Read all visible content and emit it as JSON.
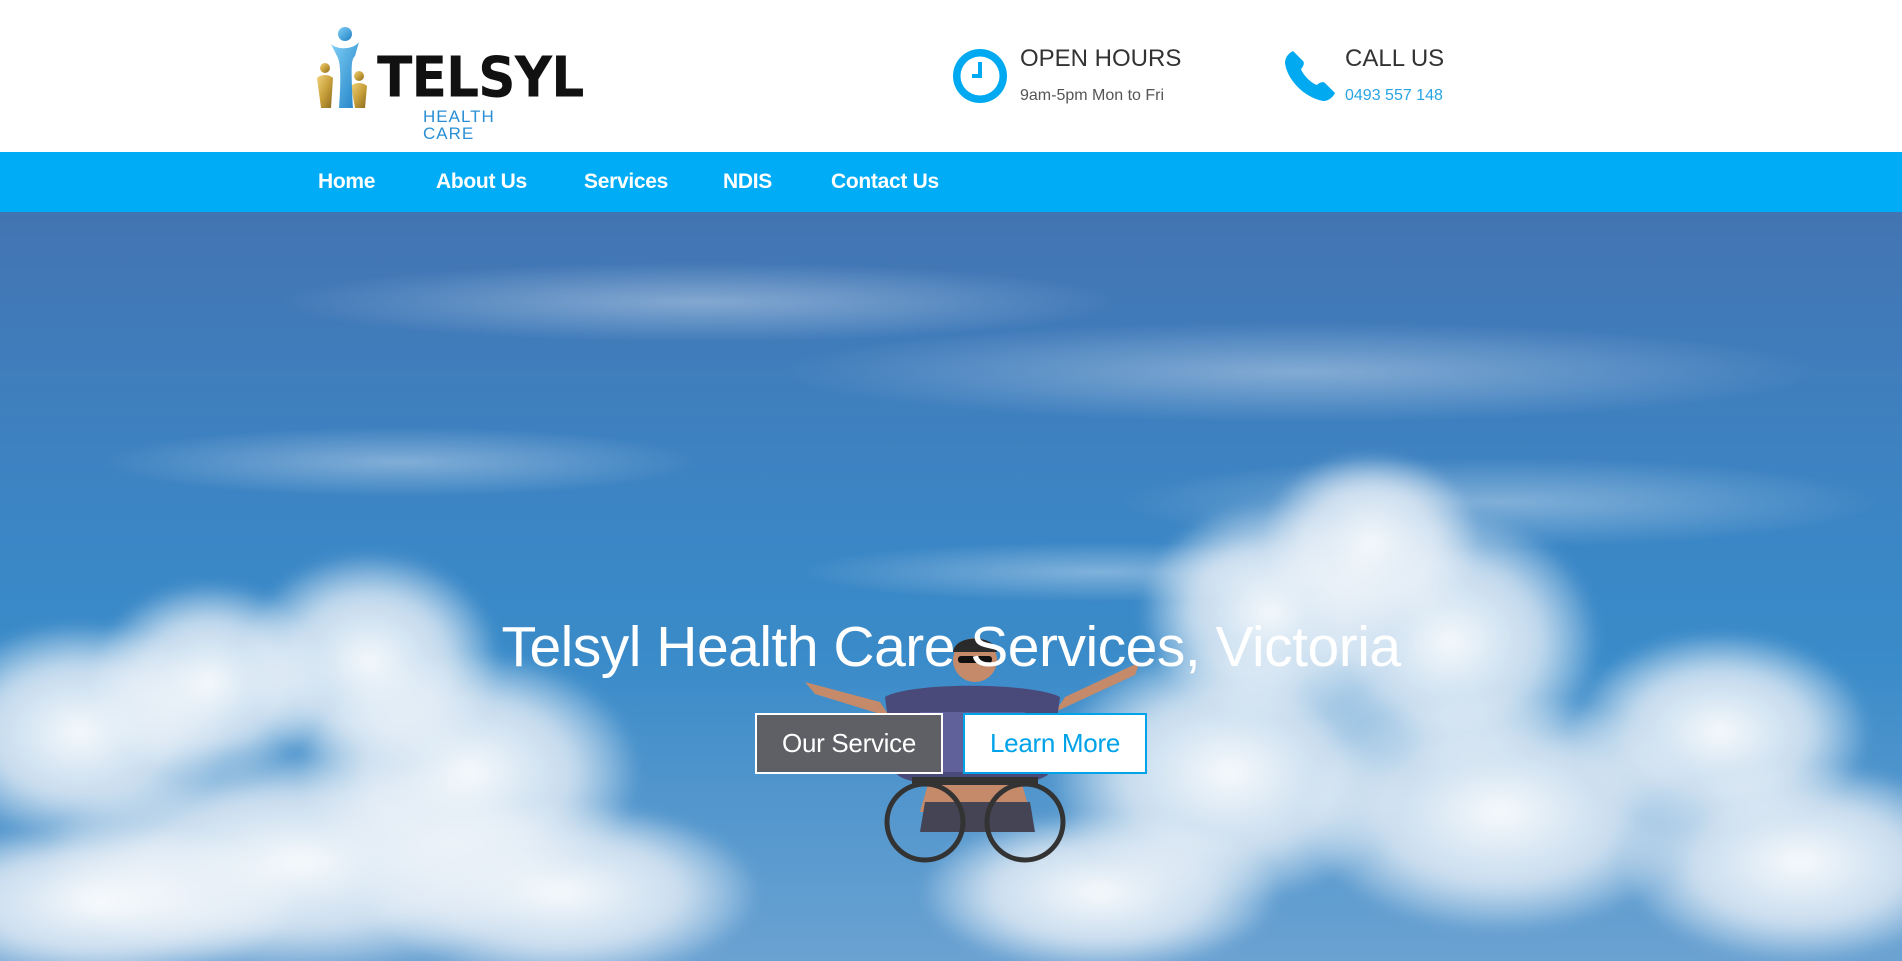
{
  "logo": {
    "word": "TELSYL",
    "sub": "HEALTH CARE"
  },
  "hours": {
    "icon": "clock-icon",
    "title": "OPEN HOURS",
    "detail": "9am-5pm Mon to Fri"
  },
  "call": {
    "icon": "phone-icon",
    "title": "CALL US",
    "phone": "0493 557 148"
  },
  "nav": {
    "items": [
      {
        "label": "Home"
      },
      {
        "label": "About Us"
      },
      {
        "label": "Services"
      },
      {
        "label": "NDIS"
      },
      {
        "label": "Contact Us"
      }
    ]
  },
  "hero": {
    "title": "Telsyl Health Care Services, Victoria",
    "primary_button": "Our Service",
    "secondary_button": "Learn More"
  },
  "colors": {
    "accent": "#00acf5",
    "button_dark": "#5f5f66",
    "text_dark": "#333333",
    "logo_gold": "#c9a13c",
    "logo_blue": "#2a8fd6"
  }
}
